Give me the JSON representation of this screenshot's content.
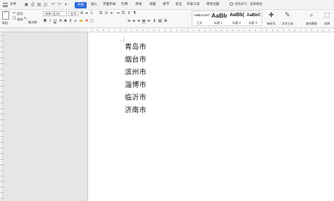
{
  "menubar": {
    "file_label": "文件",
    "tabs": [
      "开始",
      "插入",
      "页面布局",
      "引用",
      "审阅",
      "视图",
      "章节",
      "安全",
      "开发工具",
      "特色功能"
    ],
    "search_label": "查找命令、搜索模板"
  },
  "ribbon": {
    "paste_label": "粘贴",
    "cut_label": "剪切",
    "copy_label": "复制",
    "format_painter_label": "格式刷",
    "font_name": "宋体 (正文)",
    "font_size": "五号",
    "styles": [
      {
        "sample": "AaBbCcDd",
        "name": "正文"
      },
      {
        "sample": "AaBb",
        "name": "标题 1"
      },
      {
        "sample": "AaBb(",
        "name": "标题 2"
      },
      {
        "sample": "AaBbC",
        "name": "标题 3"
      }
    ],
    "new_style_label": "新样式",
    "text_tools_label": "文字工具",
    "find_replace_label": "查找替换",
    "select_label": "选择"
  },
  "document": {
    "lines": [
      "青岛市",
      "烟台市",
      "滨州市",
      "淄博市",
      "临沂市",
      "济南市"
    ]
  },
  "colors": {
    "accent": "#2f6bdc",
    "page": "#ffffff",
    "workspace": "#e6e6e6"
  }
}
